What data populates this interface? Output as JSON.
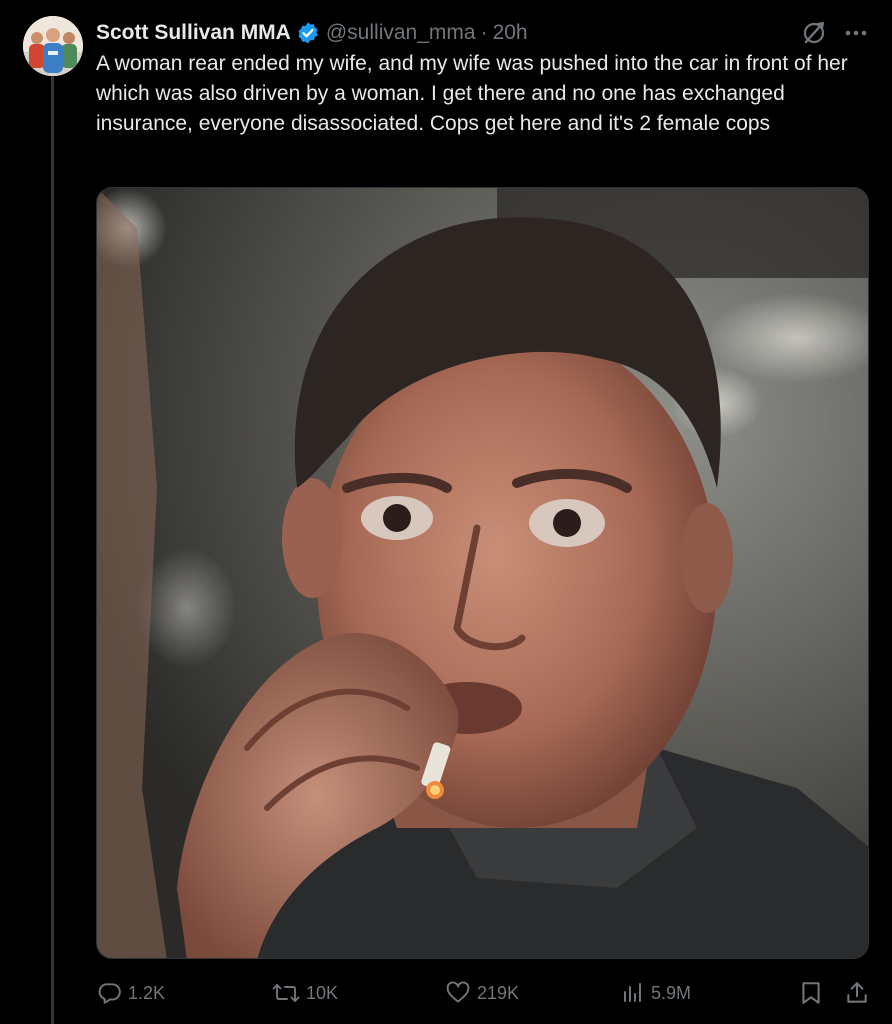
{
  "tweet": {
    "author": {
      "display_name": "Scott Sullivan MMA",
      "handle": "@sullivan_mma",
      "verified": true,
      "avatar_icon": "profile-photo"
    },
    "separator": "·",
    "time": "20h",
    "text": "A woman rear ended my wife, and my wife was pushed into the car in front of her which was also driven by a woman. I get there and no one has exchanged insurance, everyone disassociated. Cops get here and it's 2 female cops",
    "media": {
      "type": "photo",
      "icon": "image"
    },
    "top_actions": {
      "grok_icon": "grok-icon",
      "more_icon": "more-icon"
    },
    "actions": {
      "replies": "1.2K",
      "reposts": "10K",
      "likes": "219K",
      "views": "5.9M",
      "bookmark_icon": "bookmark-icon",
      "share_icon": "share-icon"
    }
  },
  "colors": {
    "background": "#000000",
    "text_primary": "#e7e9ea",
    "text_secondary": "#71767b",
    "verified_blue": "#1d9bf0",
    "divider": "#333639"
  }
}
